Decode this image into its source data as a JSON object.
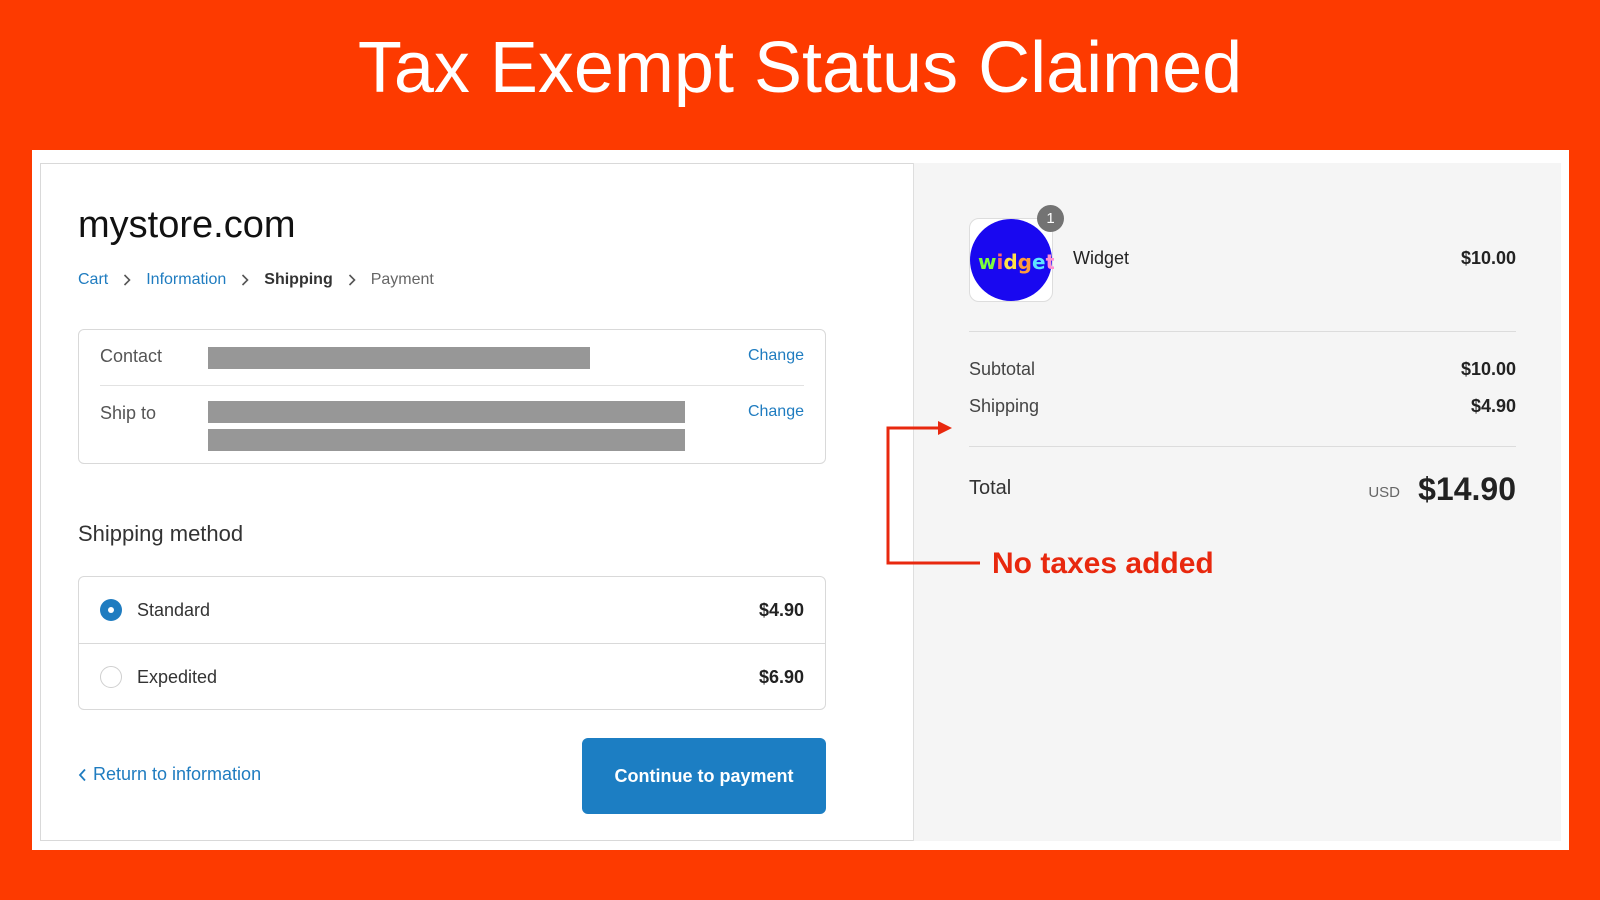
{
  "banner": {
    "title": "Tax Exempt Status Claimed"
  },
  "store": {
    "name": "mystore.com"
  },
  "breadcrumb": [
    {
      "label": "Cart",
      "state": "link"
    },
    {
      "label": "Information",
      "state": "link"
    },
    {
      "label": "Shipping",
      "state": "current"
    },
    {
      "label": "Payment",
      "state": "upcoming"
    }
  ],
  "info": {
    "contact": {
      "label": "Contact",
      "value": "[redacted]",
      "action": "Change"
    },
    "ship_to": {
      "label": "Ship to",
      "value": "[redacted]",
      "action": "Change"
    }
  },
  "shipping_method": {
    "title": "Shipping method",
    "options": [
      {
        "name": "Standard",
        "price": "$4.90",
        "selected": true
      },
      {
        "name": "Expedited",
        "price": "$6.90",
        "selected": false
      }
    ]
  },
  "footer": {
    "return_label": "Return to information",
    "continue_label": "Continue to payment"
  },
  "order_summary": {
    "item": {
      "name": "Widget",
      "price": "$10.00",
      "quantity": "1",
      "thumbnail_text": "widget"
    },
    "subtotal_label": "Subtotal",
    "subtotal_value": "$10.00",
    "shipping_label": "Shipping",
    "shipping_value": "$4.90",
    "total_label": "Total",
    "currency": "USD",
    "total_value": "$14.90"
  },
  "annotation": {
    "text": "No taxes added"
  },
  "colors": {
    "banner_bg": "#fd3a00",
    "link": "#1f7cc0",
    "primary_button": "#1c7ec3",
    "annotation": "#e8280e"
  },
  "icons": [
    "chevron-right-icon",
    "chevron-left-icon",
    "radio-selected-icon",
    "radio-unselected-icon",
    "widget-thumbnail",
    "annotation-arrow-icon"
  ]
}
